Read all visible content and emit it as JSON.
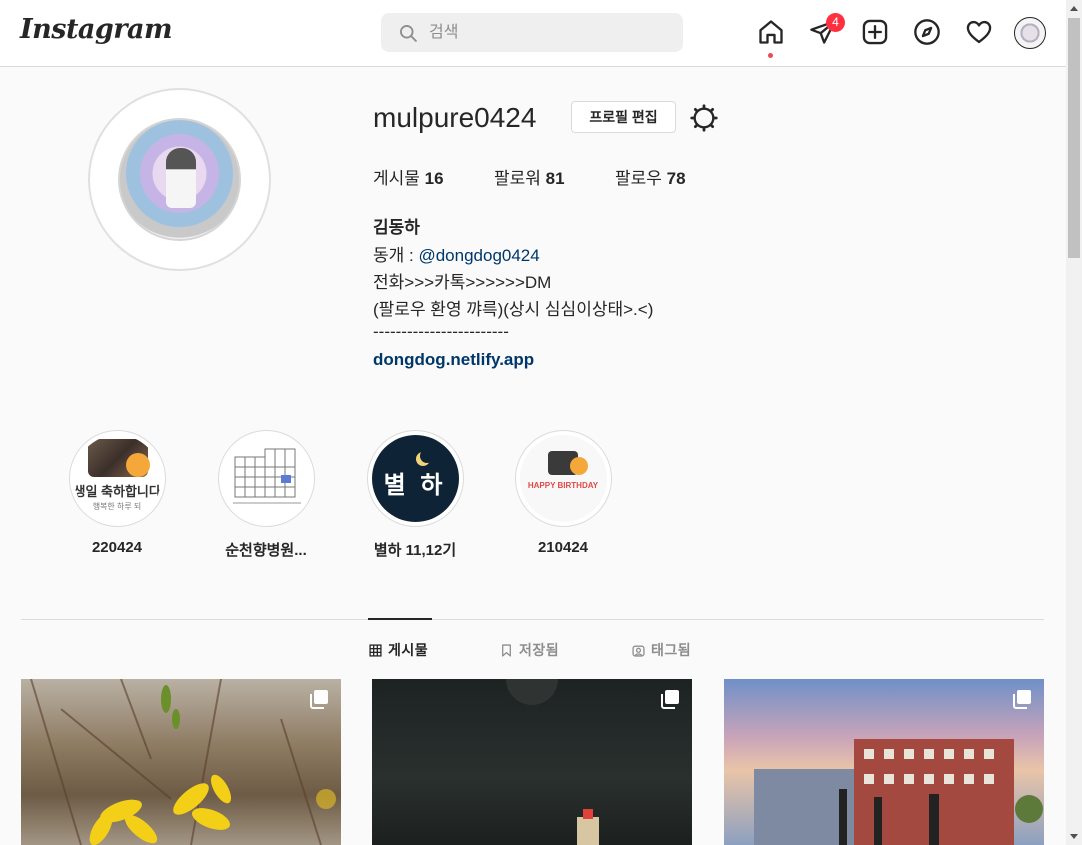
{
  "app": {
    "logo_text": "Instagram"
  },
  "search": {
    "placeholder": "검색"
  },
  "nav": {
    "icons": [
      "home-icon",
      "direct-message-icon",
      "new-post-icon",
      "explore-icon",
      "activity-heart-icon",
      "profile-avatar"
    ],
    "dm_badge_count": "4"
  },
  "profile": {
    "username": "mulpure0424",
    "edit_label": "프로필 편집",
    "stats": {
      "posts_label": "게시물",
      "posts_count": "16",
      "followers_label": "팔로워",
      "followers_count": "81",
      "following_label": "팔로우",
      "following_count": "78"
    },
    "full_name": "김동하",
    "bio": {
      "line1_prefix": "동개 : ",
      "line1_handle": "@dongdog0424",
      "line2": "전화>>>카톡>>>>>>DM",
      "line3": "(팔로우 환영 꺄륵)(상시 심심이상태>.<)",
      "line4": "------------------------"
    },
    "website": "dongdog.netlify.app"
  },
  "highlights": [
    {
      "label": "220424",
      "text_a": "생일 축하합니다",
      "text_b": "행복한 하루 되"
    },
    {
      "label": "순천향병원..."
    },
    {
      "label": "별하 11,12기",
      "text_a": "별 하"
    },
    {
      "label": "210424",
      "text_a": "HAPPY BIRTHDAY"
    }
  ],
  "tabs": [
    {
      "label": "게시물",
      "icon": "grid-icon",
      "active": true
    },
    {
      "label": "저장됨",
      "icon": "bookmark-icon",
      "active": false
    },
    {
      "label": "태그됨",
      "icon": "tag-icon",
      "active": false
    }
  ],
  "colors": {
    "accent_link": "#00376b",
    "badge": "#ff3040",
    "border": "#dbdbdb",
    "background": "#fafafa"
  }
}
